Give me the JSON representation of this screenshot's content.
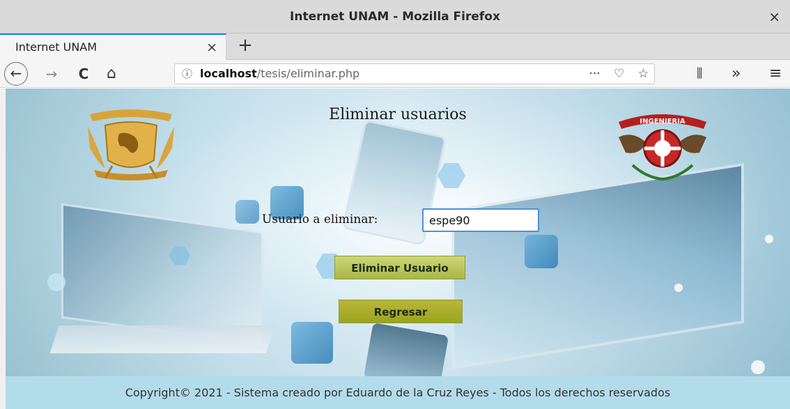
{
  "window": {
    "title": "Internet UNAM - Mozilla Firefox",
    "close_glyph": "×"
  },
  "tabs": [
    {
      "label": "Internet UNAM",
      "close_glyph": "×",
      "active": true
    }
  ],
  "newtab_glyph": "+",
  "nav": {
    "back_icon": "←",
    "forward_icon": "→",
    "reload_icon": "C",
    "home_icon": "⌂",
    "info_icon": "ⓘ",
    "url_host": "localhost",
    "url_path": "/tesis/eliminar.php",
    "page_actions_icon": "···",
    "pocket_icon": "♡",
    "bookmark_icon": "☆",
    "library_icon": "⫼",
    "overflow_icon": "»",
    "menu_icon": "≡"
  },
  "page": {
    "heading": "Eliminar usuarios",
    "seal_fi_text": "INGENIERIA",
    "form": {
      "label": "Usuario a eliminar:",
      "value": "espe90"
    },
    "buttons": {
      "delete": "Eliminar Usuario",
      "back": "Regresar"
    },
    "footer": "Copyright© 2021 - Sistema creado por Eduardo de la Cruz Reyes - Todos los derechos reservados"
  },
  "colors": {
    "tab_accent": "#0a84ff",
    "input_focus": "#4d8fe0",
    "button_delete": "#b8c45a",
    "button_back": "#a8ae2b",
    "footer_bg": "#b3dceb"
  }
}
